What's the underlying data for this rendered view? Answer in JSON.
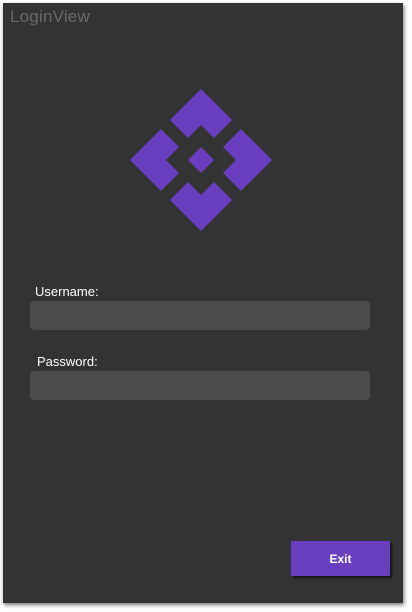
{
  "window": {
    "title": "LoginView"
  },
  "logo": {
    "icon": "diamond-grid-logo-icon",
    "color": "#6a3fbf"
  },
  "form": {
    "username_label": "Username:",
    "username_value": "",
    "password_label": "Password:",
    "password_value": ""
  },
  "actions": {
    "exit_label": "Exit"
  },
  "colors": {
    "background": "#333333",
    "field": "#4b4b4b",
    "accent": "#6a3fbf",
    "title_text": "#6a6a6a"
  }
}
